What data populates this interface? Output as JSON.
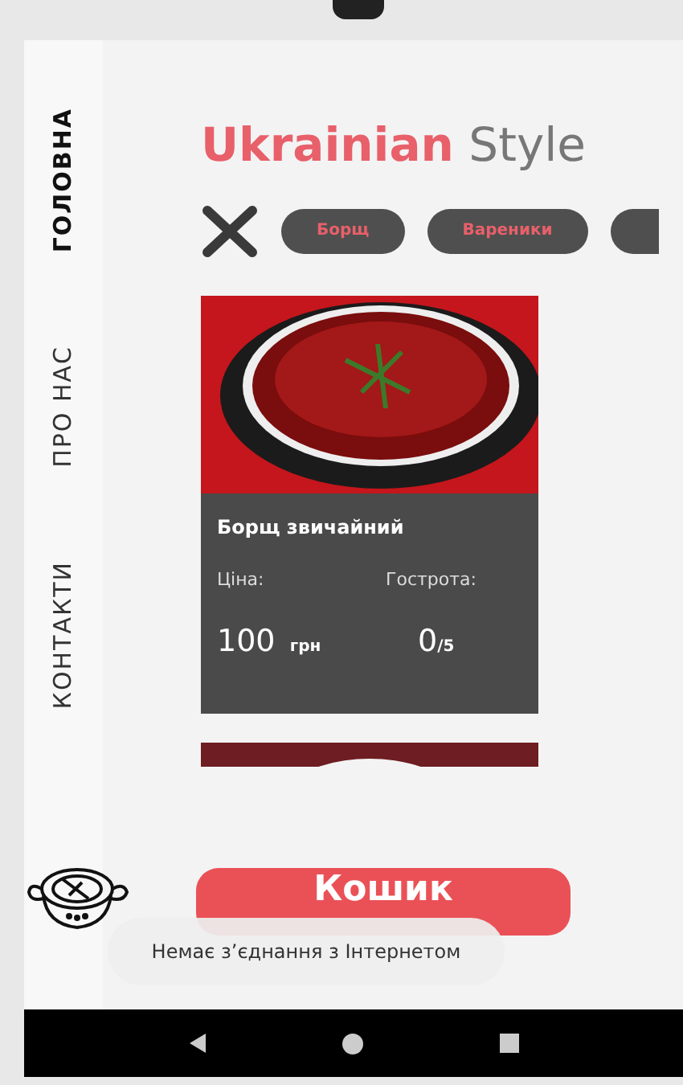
{
  "sidebar": {
    "items": [
      {
        "label": "ГОЛОВНА",
        "selected": true
      },
      {
        "label": "ПРО НАС",
        "selected": false
      },
      {
        "label": "КОНТАКТИ",
        "selected": false
      }
    ]
  },
  "title": {
    "accent": "Ukrainian",
    "rest": "Style"
  },
  "categories": [
    {
      "kind": "full",
      "label": "Борщ"
    },
    {
      "kind": "full",
      "label": "Вареники"
    },
    {
      "kind": "partial"
    }
  ],
  "dishes": [
    {
      "kind": "full",
      "name": "Борщ звичайний",
      "price_label": "Ціна:",
      "spice_label": "Гострота:",
      "price": "100",
      "currency": "грн",
      "spice": "0",
      "spice_max": "/5"
    },
    {
      "kind": "partial"
    }
  ],
  "cart_button": "Кошик",
  "toast": "Немає з’єднання з Інтернетом"
}
